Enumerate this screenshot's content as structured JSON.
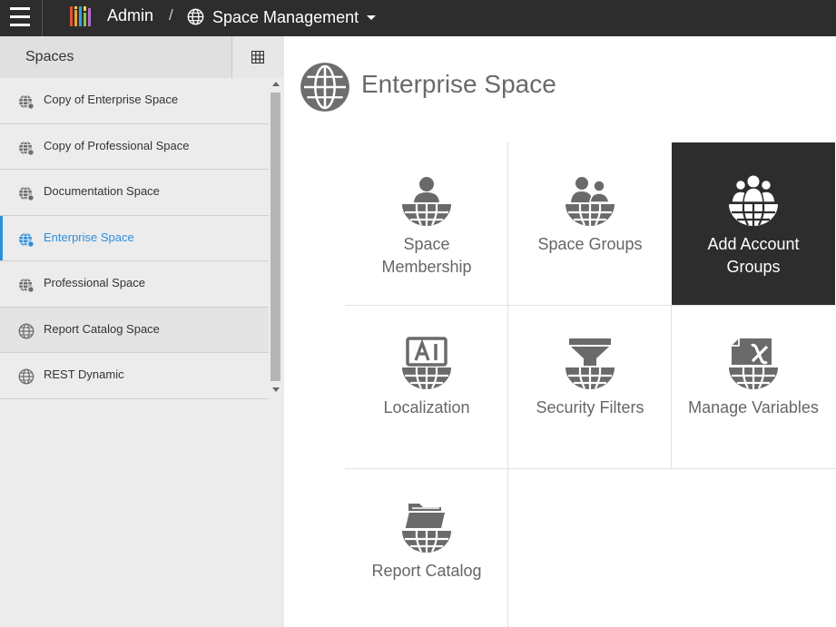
{
  "topbar": {
    "admin_label": "Admin",
    "separator": "/",
    "current_label": "Space Management",
    "colors": {
      "bg": "#2d2d2d",
      "text": "#ffffff"
    }
  },
  "sidebar": {
    "title": "Spaces",
    "items": [
      {
        "label": "Copy of Enterprise Space",
        "active": false
      },
      {
        "label": "Copy of Professional Space",
        "active": false
      },
      {
        "label": "Documentation Space",
        "active": false
      },
      {
        "label": "Enterprise Space",
        "active": true
      },
      {
        "label": "Professional Space",
        "active": false
      },
      {
        "label": "Report Catalog Space",
        "active": false
      },
      {
        "label": "REST Dynamic",
        "active": false
      }
    ],
    "accent_color": "#2b8fde"
  },
  "main": {
    "title": "Enterprise Space",
    "tiles": [
      {
        "label_lines": [
          "Space",
          "Membership"
        ],
        "icon": "person-globe-icon",
        "selected": false
      },
      {
        "label_lines": [
          "Space Groups"
        ],
        "icon": "two-people-globe-icon",
        "selected": false
      },
      {
        "label_lines": [
          "Add Account",
          "Groups"
        ],
        "icon": "group-globe-icon",
        "selected": true
      },
      {
        "label_lines": [
          "Localization"
        ],
        "icon": "language-globe-icon",
        "selected": false
      },
      {
        "label_lines": [
          "Security Filters"
        ],
        "icon": "funnel-globe-icon",
        "selected": false
      },
      {
        "label_lines": [
          "Manage Variables"
        ],
        "icon": "variable-globe-icon",
        "selected": false
      },
      {
        "label_lines": [
          "Report Catalog"
        ],
        "icon": "folder-globe-icon",
        "selected": false
      }
    ],
    "colors": {
      "selected_bg": "#2d2d2d",
      "icon_gray": "#6a6a6a"
    }
  }
}
